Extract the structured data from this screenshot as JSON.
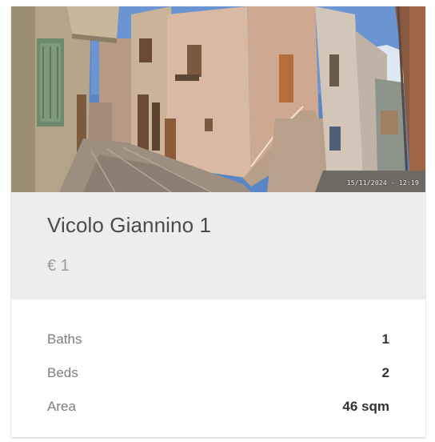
{
  "listing": {
    "photo": {
      "icon": "street-photo",
      "timestamp": "15/11/2024 - 12:19"
    },
    "title": "Vicolo Giannino 1",
    "price": "€ 1"
  },
  "details": {
    "rows": [
      {
        "label": "Baths",
        "value": "1"
      },
      {
        "label": "Beds",
        "value": "2"
      },
      {
        "label": "Area",
        "value": "46 sqm"
      }
    ]
  },
  "colors": {
    "info_background": "#ededee",
    "title_text": "#4a4a4a",
    "price_text": "#9b9b9b",
    "label_text": "#7d7d7d",
    "value_text": "#333333"
  }
}
